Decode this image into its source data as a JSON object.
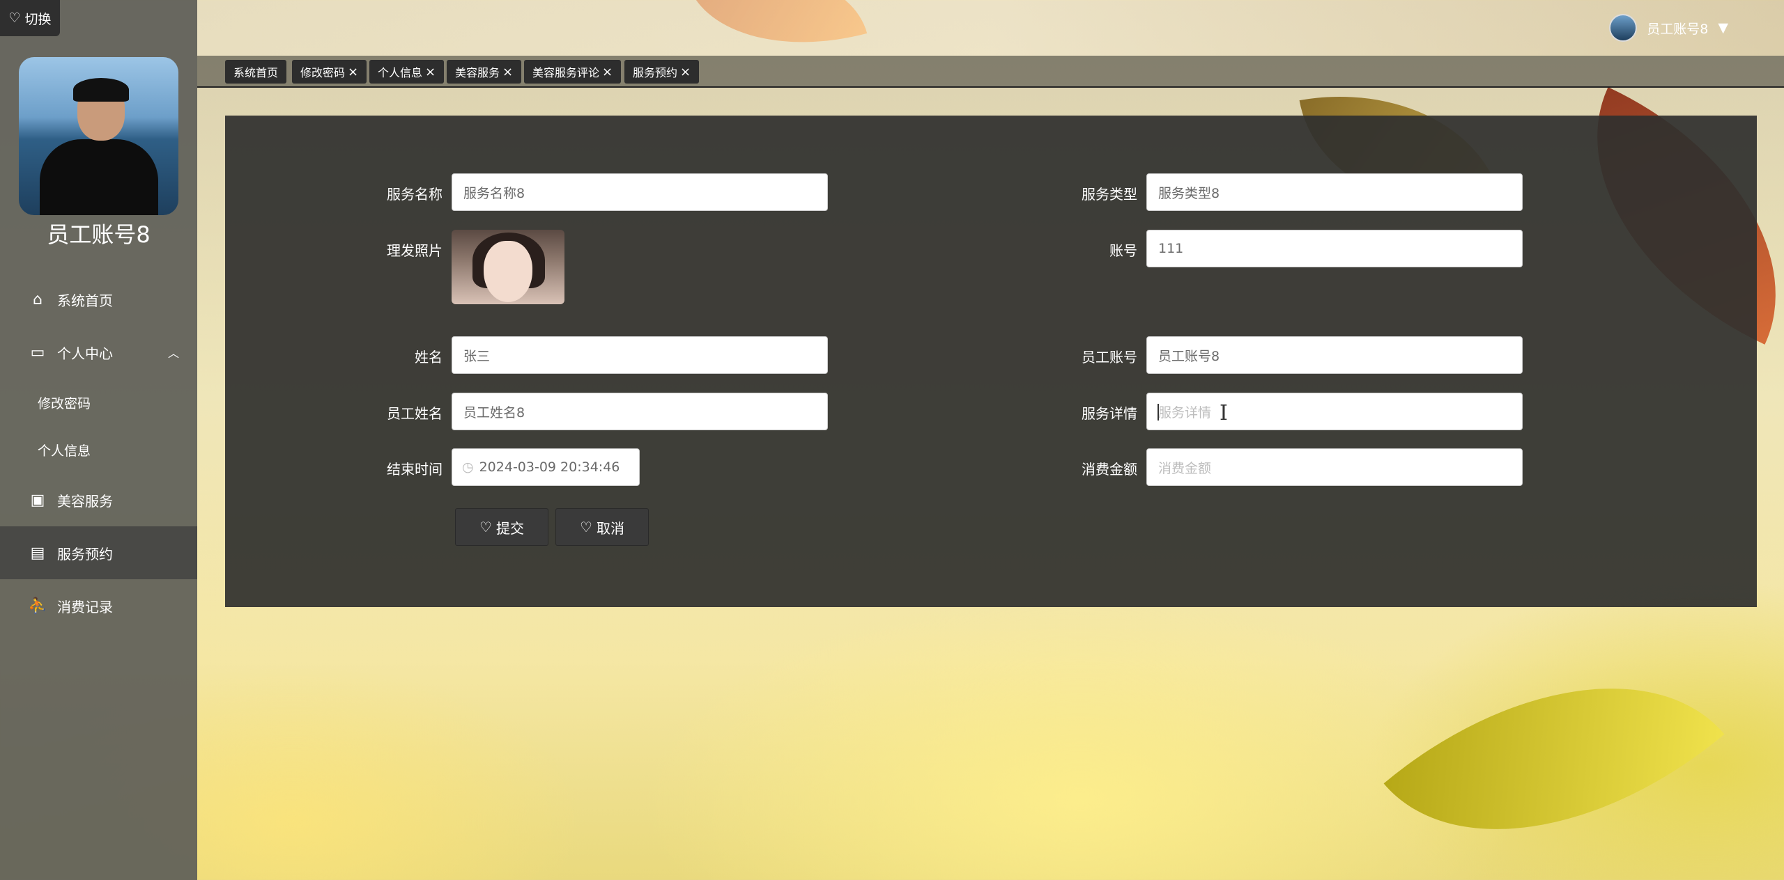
{
  "switch_label": "切换",
  "sidebar": {
    "username": "员工账号8",
    "items": [
      {
        "label": "系统首页",
        "icon": "home-icon"
      },
      {
        "label": "个人中心",
        "icon": "card-icon"
      },
      {
        "label": "修改密码"
      },
      {
        "label": "个人信息"
      },
      {
        "label": "美容服务",
        "icon": "clipboard-icon"
      },
      {
        "label": "服务预约",
        "icon": "chat-icon"
      },
      {
        "label": "消费记录",
        "icon": "user-icon"
      }
    ]
  },
  "header": {
    "user_name": "员工账号8"
  },
  "tabs": [
    {
      "label": "系统首页"
    },
    {
      "label": "修改密码"
    },
    {
      "label": "个人信息"
    },
    {
      "label": "美容服务"
    },
    {
      "label": "美容服务评论"
    },
    {
      "label": "服务预约"
    }
  ],
  "form": {
    "service_name": {
      "label": "服务名称",
      "value": "服务名称8"
    },
    "service_type": {
      "label": "服务类型",
      "value": "服务类型8"
    },
    "photo": {
      "label": "理发照片"
    },
    "account": {
      "label": "账号",
      "value": "111"
    },
    "name": {
      "label": "姓名",
      "value": "张三"
    },
    "staff_account": {
      "label": "员工账号",
      "value": "员工账号8"
    },
    "staff_name": {
      "label": "员工姓名",
      "value": "员工姓名8"
    },
    "service_detail": {
      "label": "服务详情",
      "placeholder": "服务详情"
    },
    "end_time": {
      "label": "结束时间",
      "value": "2024-03-09 20:34:46"
    },
    "amount": {
      "label": "消费金额",
      "placeholder": "消费金额"
    },
    "submit_label": "提交",
    "cancel_label": "取消"
  }
}
